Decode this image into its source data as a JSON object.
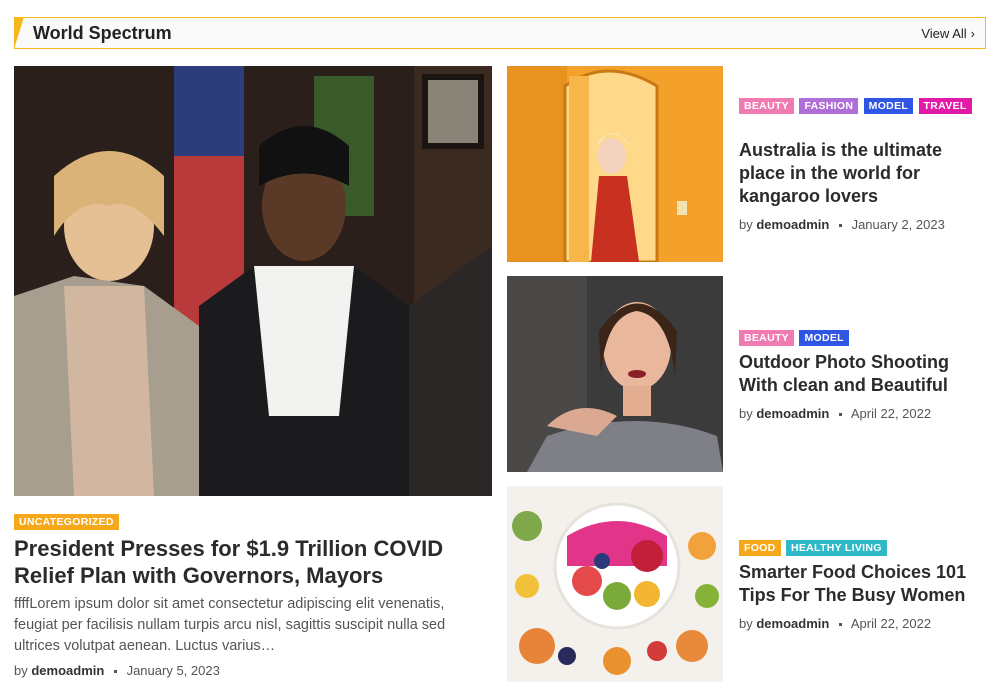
{
  "section": {
    "title": "World Spectrum",
    "view_all": "View All"
  },
  "colors": {
    "accent": "#f5b71a",
    "beauty": "#f07bb0",
    "fashion": "#b06fd8",
    "model": "#2f55e4",
    "travel": "#e31aa7",
    "uncategorized": "#f5a81a",
    "food": "#f5a81a",
    "healthy_living": "#2fb8c6"
  },
  "main_post": {
    "categories": [
      "UNCATEGORIZED"
    ],
    "title": "President Presses for $1.9 Trillion COVID Relief Plan with Governors, Mayors",
    "excerpt": "ffffLorem ipsum dolor sit amet consectetur adipiscing elit venenatis, feugiat per facilisis nullam turpis arcu nisl, sagittis suscipit nulla sed ultrices volutpat aenean. Luctus varius…",
    "by": "by",
    "author": "demoadmin",
    "date": "January 5, 2023"
  },
  "side_posts": [
    {
      "categories": [
        "BEAUTY",
        "FASHION",
        "MODEL",
        "TRAVEL"
      ],
      "title": "Australia is the ultimate place in the world for kangaroo lovers",
      "by": "by",
      "author": "demoadmin",
      "date": "January 2, 2023"
    },
    {
      "categories": [
        "BEAUTY",
        "MODEL"
      ],
      "title": "Outdoor Photo Shooting With clean and Beautiful",
      "by": "by",
      "author": "demoadmin",
      "date": "April 22, 2022"
    },
    {
      "categories": [
        "FOOD",
        "HEALTHY LIVING"
      ],
      "title": "Smarter Food Choices 101 Tips For The Busy Women",
      "by": "by",
      "author": "demoadmin",
      "date": "April 22, 2022"
    }
  ]
}
